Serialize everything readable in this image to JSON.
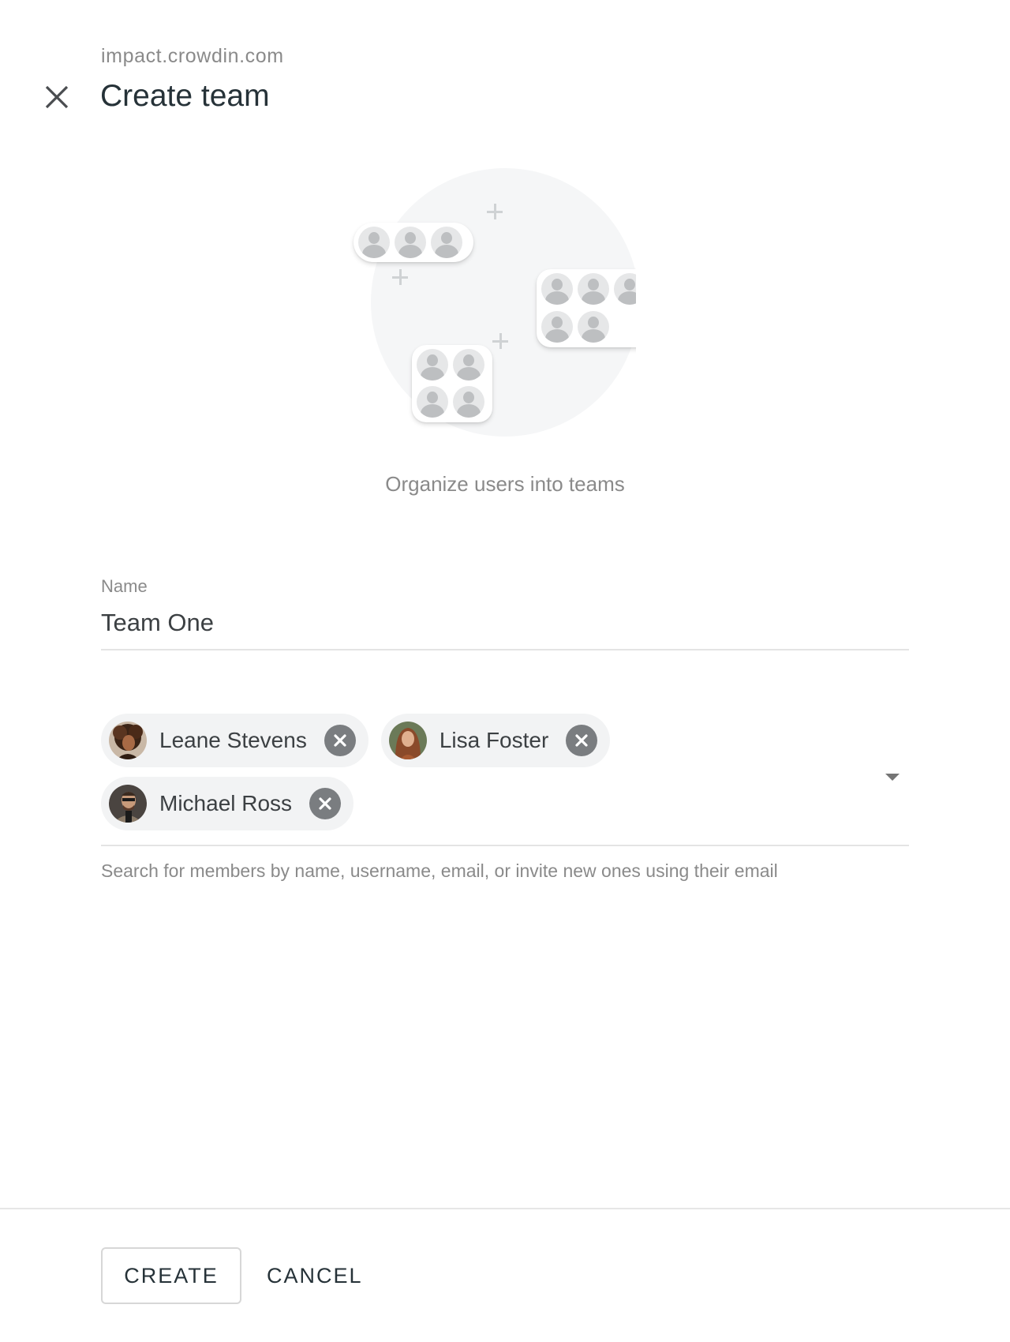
{
  "header": {
    "domain": "impact.crowdin.com",
    "title": "Create team",
    "close_icon": "close-icon"
  },
  "illustration": {
    "subtitle": "Organize users into teams",
    "icon": "team-groups-illustration"
  },
  "form": {
    "name_label": "Name",
    "name_value": "Team One",
    "members": [
      {
        "name": "Leane Stevens",
        "remove_icon": "remove-circle-icon"
      },
      {
        "name": "Lisa Foster",
        "remove_icon": "remove-circle-icon"
      },
      {
        "name": "Michael Ross",
        "remove_icon": "remove-circle-icon"
      }
    ],
    "members_helper": "Search for members by name, username, email, or invite new ones using their email",
    "dropdown_icon": "arrow-drop-down-icon"
  },
  "footer": {
    "create_label": "CREATE",
    "cancel_label": "CANCEL"
  },
  "colors": {
    "text_primary": "#263238",
    "text_secondary": "#8a8a8a",
    "chip_background": "#f2f3f4",
    "chip_remove": "#7a7d80",
    "divider": "#e4e4e4"
  }
}
